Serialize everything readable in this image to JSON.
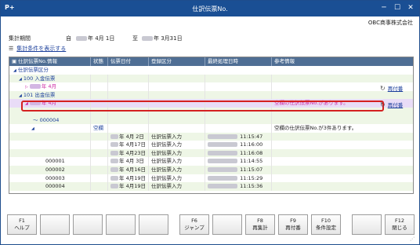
{
  "titlebar": {
    "app_icon": "P+",
    "title": "仕訳伝票No.",
    "minimize": "─",
    "maximize": "☐",
    "close": "✕"
  },
  "company": "OBC商事株式会社",
  "period": {
    "label": "集計期間",
    "from_label": "自",
    "from_date": "年  4月 1日",
    "to_label": "至",
    "to_date": "年  3月31日"
  },
  "condition_link": "集計条件を表示する",
  "table": {
    "headers": [
      "仕訳伝票No.情報",
      "状態",
      "伝票日付",
      "登録区分",
      "最終処理日時",
      "参考情報"
    ],
    "tree": {
      "root": "仕訳伝票区分",
      "n100": "100  入金伝票",
      "n100_month": "年  4月",
      "n101": "101  出金伝票",
      "n101_month": "年  4月",
      "range": "～ 000004",
      "empty_status": "空欄"
    },
    "info_month": "空欄の仕訳伝票No.があります。",
    "info_empty": "空欄の仕訳伝票No.が3件あります。",
    "renumber": "再付番",
    "rows": [
      {
        "no": "",
        "date": "年  4月 2日",
        "type": "仕訳伝票入力",
        "time": "11:15:47"
      },
      {
        "no": "",
        "date": "年  4月17日",
        "type": "仕訳伝票入力",
        "time": "11:16:00"
      },
      {
        "no": "",
        "date": "年  4月23日",
        "type": "仕訳伝票入力",
        "time": "11:16:08"
      },
      {
        "no": "000001",
        "date": "年  4月 3日",
        "type": "仕訳伝票入力",
        "time": "11:14:55"
      },
      {
        "no": "000002",
        "date": "年  4月16日",
        "type": "仕訳伝票入力",
        "time": "11:15:07"
      },
      {
        "no": "000003",
        "date": "年  4月19日",
        "type": "仕訳伝票入力",
        "time": "11:15:29"
      },
      {
        "no": "000004",
        "date": "年  4月19日",
        "type": "仕訳伝票入力",
        "time": "11:15:36"
      }
    ]
  },
  "fkeys": [
    {
      "key": "F1",
      "label": "ヘルプ"
    },
    {
      "key": "",
      "label": ""
    },
    {
      "key": "",
      "label": ""
    },
    {
      "key": "",
      "label": ""
    },
    {
      "key": "",
      "label": ""
    },
    {
      "key": "F6",
      "label": "ジャンプ"
    },
    {
      "key": "",
      "label": ""
    },
    {
      "key": "F8",
      "label": "再集計"
    },
    {
      "key": "F9",
      "label": "再付番"
    },
    {
      "key": "F10",
      "label": "条件設定"
    },
    {
      "key": "",
      "label": ""
    },
    {
      "key": "F12",
      "label": "閉じる"
    }
  ]
}
